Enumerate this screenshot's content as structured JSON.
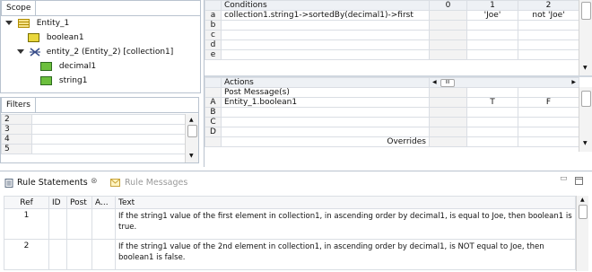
{
  "scope": {
    "tab_label": "Scope",
    "tree": [
      {
        "label": "Entity_1",
        "icon": "entity-icon"
      },
      {
        "label": "boolean1",
        "icon": "boolean-attribute-icon"
      },
      {
        "label": "entity_2 (Entity_2) [collection1]",
        "icon": "association-icon"
      },
      {
        "label": "decimal1",
        "icon": "decimal-attribute-icon"
      },
      {
        "label": "string1",
        "icon": "string-attribute-icon"
      }
    ]
  },
  "filters": {
    "tab_label": "Filters",
    "rows": [
      "2",
      "3",
      "4",
      "5"
    ]
  },
  "decision_table": {
    "conditions_label": "Conditions",
    "col_headers": [
      "0",
      "1",
      "2"
    ],
    "condition_rows": [
      {
        "id": "a",
        "expr": "collection1.string1->sortedBy(decimal1)->first",
        "c0": "",
        "c1": "'Joe'",
        "c2": "not 'Joe'"
      },
      {
        "id": "b",
        "expr": "",
        "c0": "",
        "c1": "",
        "c2": ""
      },
      {
        "id": "c",
        "expr": "",
        "c0": "",
        "c1": "",
        "c2": ""
      },
      {
        "id": "d",
        "expr": "",
        "c0": "",
        "c1": "",
        "c2": ""
      },
      {
        "id": "e",
        "expr": "",
        "c0": "",
        "c1": "",
        "c2": ""
      }
    ],
    "actions_label": "Actions",
    "hscroll_glyph": "III",
    "post_message_label": "Post Message(s)",
    "action_rows": [
      {
        "id": "A",
        "expr": "Entity_1.boolean1",
        "c0": "",
        "c1": "T",
        "c2": "F"
      },
      {
        "id": "B",
        "expr": "",
        "c0": "",
        "c1": "",
        "c2": ""
      },
      {
        "id": "C",
        "expr": "",
        "c0": "",
        "c1": "",
        "c2": ""
      },
      {
        "id": "D",
        "expr": "",
        "c0": "",
        "c1": "",
        "c2": ""
      }
    ],
    "overrides_label": "Overrides"
  },
  "bottom_panel": {
    "tab_rule_statements": "Rule Statements",
    "tab_rule_messages": "Rule Messages",
    "close_glyph": "⊗",
    "columns": [
      "Ref",
      "ID",
      "Post",
      "A...",
      "Text"
    ],
    "rows": [
      {
        "ref": "1",
        "id": "",
        "post": "",
        "a": "",
        "text": "If the string1 value of the first element in collection1, in ascending order by decimal1, is equal to Joe, then boolean1 is true."
      },
      {
        "ref": "2",
        "id": "",
        "post": "",
        "a": "",
        "text": "If the string1 value of the 2nd element in collection1, in ascending order by decimal1, is NOT equal to Joe, then boolean1 is false."
      }
    ]
  },
  "colors": {
    "border": "#b9c3cf",
    "header_bg": "#eef1f5",
    "boolean_icon": "#e9d73d",
    "decimal_icon": "#6cbf3d"
  }
}
